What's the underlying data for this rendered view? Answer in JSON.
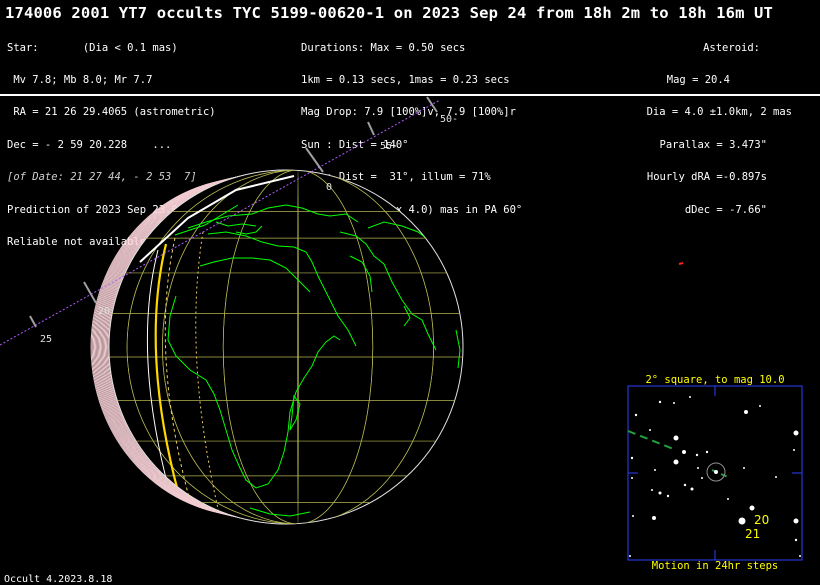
{
  "header": {
    "title": "174006 2001 YT7 occults TYC 5199-00620-1 on 2023 Sep 24 from 18h  2m to 18h 16m UT",
    "star": {
      "heading": "Star:       (Dia < 0.1 mas)",
      "magnitudes": " Mv 7.8; Mb 8.0; Mr 7.7",
      "ra": " RA = 21 26 29.4065 (astrometric)",
      "dec": "Dec = - 2 59 20.228    ...",
      "of_date": "[of Date: 21 27 44, - 2 53  7]",
      "prediction": "Prediction of 2023 Sep 23.0",
      "reliable": "Reliable not available"
    },
    "event": {
      "durations": "Durations: Max = 0.50 secs",
      "scale": "1km = 0.13 secs, 1mas = 0.23 secs",
      "mag_drop": "Mag Drop: 7.9 [100%]v, 7.9 [100%]r",
      "sun": "Sun : Dist = 140°",
      "moon": "Moon: Dist =  31°, illum = 71%",
      "error": "1σ Err: ±(31.0 x 4.0) mas in PA 60°"
    },
    "asteroid": {
      "heading": "Asteroid:",
      "mag": "Mag = 20.4",
      "dia": "Dia = 4.0 ±1.0km, 2 mas",
      "parallax": "Parallax = 3.473\"",
      "hourly_dra": "Hourly dRA =-0.897s",
      "ddec": "dDec = -7.66\""
    }
  },
  "track_labels": {
    "t50": "50-",
    "t55": "55-",
    "t0": "0",
    "t20": "20",
    "t25": "25"
  },
  "inset": {
    "title": "2° square, to mag 10.0",
    "footer": "Motion in 24hr steps",
    "step_label_1": "20",
    "step_label_2": "21"
  },
  "footer": {
    "version": "Occult 4.2023.8.18"
  },
  "colors": {
    "background": "#000000",
    "coastline": "#00ff00",
    "grid": "#b4b450",
    "path_limit": "#ffd700",
    "error_limit": "#e8c850",
    "shadow": "#ffd0d8",
    "track": "#b05cff",
    "inset_frame": "#2a3fff",
    "inset_text": "#ffff00"
  }
}
